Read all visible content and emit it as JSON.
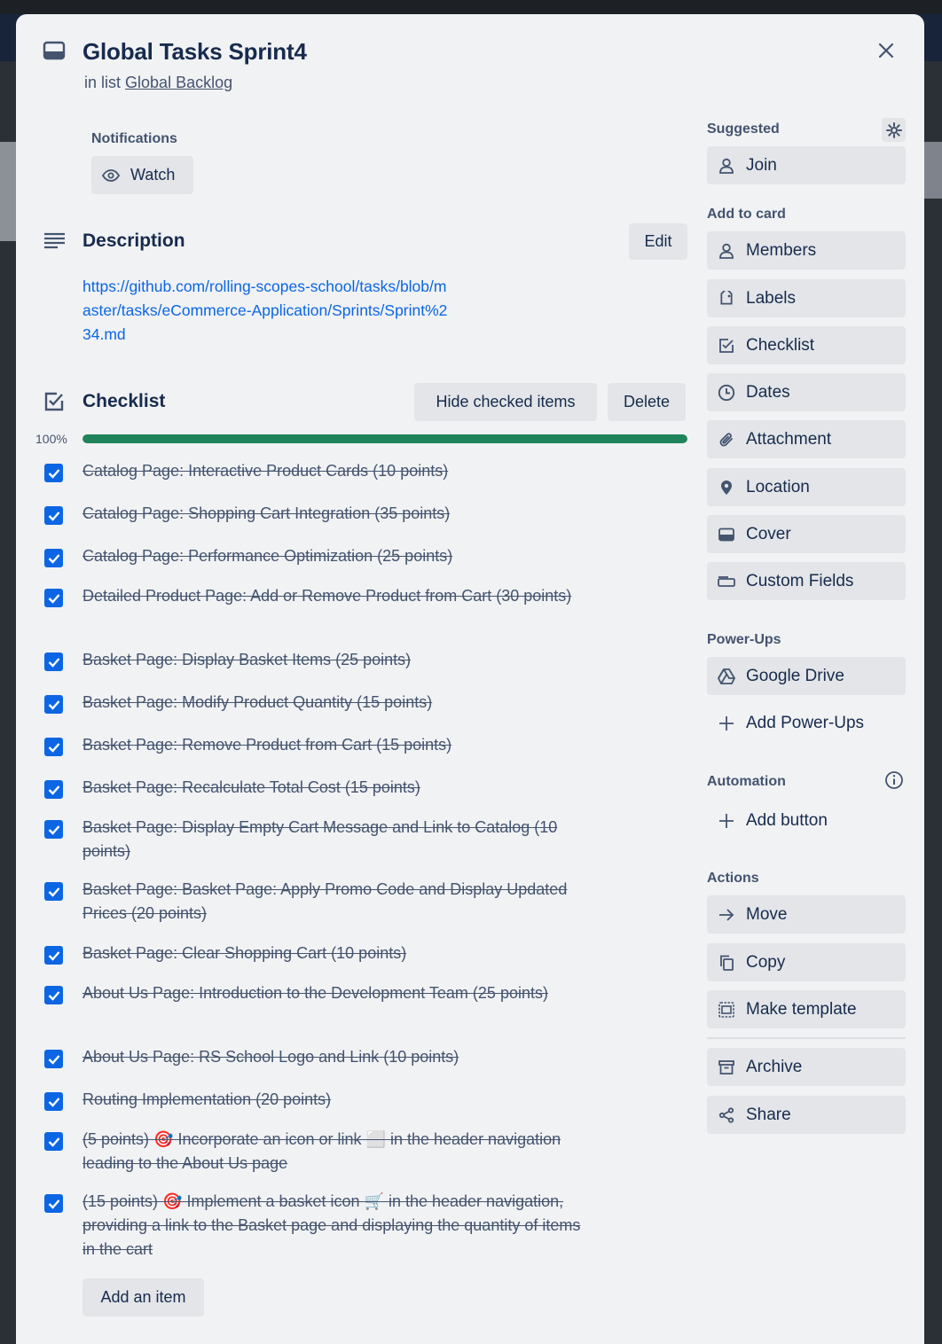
{
  "card": {
    "title": "Global Tasks Sprint4",
    "in_list_prefix": "in list",
    "list_name": "Global Backlog"
  },
  "notifications": {
    "label": "Notifications",
    "watch_label": "Watch"
  },
  "description": {
    "heading": "Description",
    "edit_label": "Edit",
    "link_text": "https://github.com/rolling-scopes-school/tasks/blob/master/tasks/eCommerce-Application/Sprints/Sprint%234.md"
  },
  "checklist": {
    "heading": "Checklist",
    "hide_checked_label": "Hide checked items",
    "delete_label": "Delete",
    "progress_text": "100%",
    "progress_fraction": 1.0,
    "add_item_label": "Add an item",
    "items": [
      {
        "text": "Catalog Page: Interactive Product Cards (10 points)",
        "checked": true
      },
      {
        "text": "Catalog Page: Shopping Cart Integration (35 points)",
        "checked": true
      },
      {
        "text": "Catalog Page: Performance Optimization (25 points)",
        "checked": true
      },
      {
        "text": "Detailed Product Page: Add or Remove Product from Cart (30 points)",
        "checked": true
      },
      {
        "text": "Basket Page: Display Basket Items (25 points)",
        "checked": true
      },
      {
        "text": "Basket Page: Modify Product Quantity (15 points)",
        "checked": true
      },
      {
        "text": "Basket Page: Remove Product from Cart (15 points)",
        "checked": true
      },
      {
        "text": "Basket Page: Recalculate Total Cost (15 points)",
        "checked": true
      },
      {
        "text": "Basket Page: Display Empty Cart Message and Link to Catalog (10 points)",
        "checked": true
      },
      {
        "text": "Basket Page: Basket Page: Apply Promo Code and Display Updated Prices (20 points)",
        "checked": true
      },
      {
        "text": "Basket Page: Clear Shopping Cart (10 points)",
        "checked": true
      },
      {
        "text": "About Us Page: Introduction to the Development Team (25 points)",
        "checked": true
      },
      {
        "text": "About Us Page: RS School Logo and Link (10 points)",
        "checked": true
      },
      {
        "text": "Routing Implementation (20 points)",
        "checked": true
      },
      {
        "text": "(5 points) 🎯 Incorporate an icon or link ⬜ in the header navigation leading to the About Us page",
        "checked": true
      },
      {
        "text": "(15 points) 🎯 Implement a basket icon 🛒 in the header navigation, providing a link to the Basket page and displaying the quantity of items in the cart",
        "checked": true
      }
    ]
  },
  "sidebar": {
    "suggested_label": "Suggested",
    "join_label": "Join",
    "add_to_card_label": "Add to card",
    "add_to_card": [
      {
        "label": "Members",
        "icon": "person-icon"
      },
      {
        "label": "Labels",
        "icon": "tag-icon"
      },
      {
        "label": "Checklist",
        "icon": "checklist-icon"
      },
      {
        "label": "Dates",
        "icon": "clock-icon"
      },
      {
        "label": "Attachment",
        "icon": "paperclip-icon"
      },
      {
        "label": "Location",
        "icon": "location-pin-icon"
      },
      {
        "label": "Cover",
        "icon": "cover-icon"
      },
      {
        "label": "Custom Fields",
        "icon": "custom-fields-icon"
      }
    ],
    "powerups_label": "Power-Ups",
    "google_drive_label": "Google Drive",
    "add_powerups_label": "Add Power-Ups",
    "automation_label": "Automation",
    "add_button_label": "Add button",
    "actions_label": "Actions",
    "actions": [
      {
        "label": "Move",
        "icon": "arrow-right-icon"
      },
      {
        "label": "Copy",
        "icon": "copy-icon"
      },
      {
        "label": "Make template",
        "icon": "template-icon"
      }
    ],
    "archive_label": "Archive",
    "share_label": "Share"
  },
  "colors": {
    "checkbox": "#0c66e4",
    "progress": "#1f845a",
    "link": "#0c66e4",
    "button_bg": "#e3e5e8",
    "modal_bg": "#f1f2f4"
  }
}
